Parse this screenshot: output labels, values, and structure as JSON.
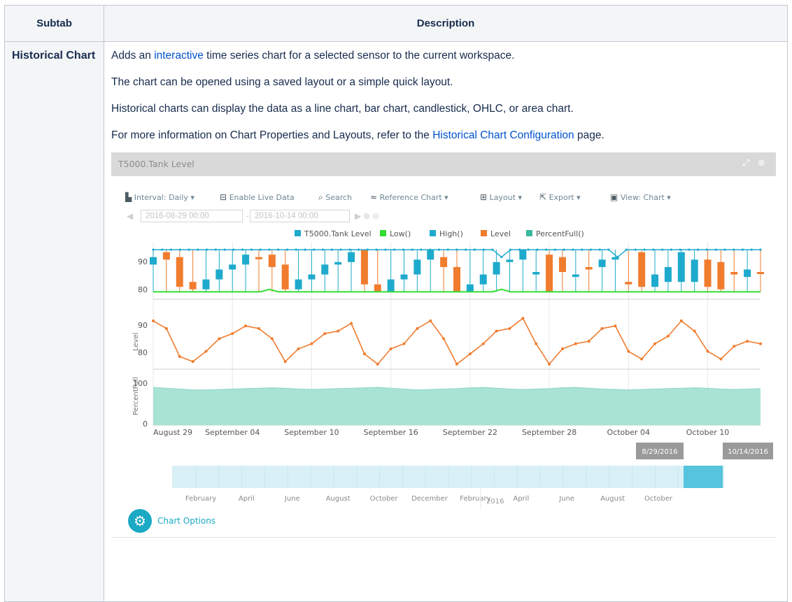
{
  "table": {
    "headers": [
      "Subtab",
      "Description"
    ],
    "row": {
      "subtab": "Historical Chart",
      "p1_before": "Adds an ",
      "p1_link": "interactive",
      "p1_after": " time series chart for a selected sensor to the current workspace.",
      "p2": "The chart can be opened using a saved layout or a simple quick layout.",
      "p3": "Historical charts can display the data as a line chart, bar chart, candlestick, OHLC, or area chart.",
      "p4_before": "For more information on Chart Properties and Layouts, refer to the ",
      "p4_link": "Historical Chart Configuration",
      "p4_after": " page."
    }
  },
  "widget": {
    "title": "T5000.Tank Level",
    "toolbar": {
      "interval": "Interval: Daily",
      "live": "Enable Live Data",
      "search": "Search",
      "reference": "Reference Chart",
      "layout": "Layout",
      "export": "Export",
      "view": "View: Chart"
    },
    "date_from": "2016-08-29 00:00",
    "date_to": "2016-10-14 00:00",
    "range_start_label": "8/29/2016",
    "range_end_label": "10/14/2016",
    "chart_options": "Chart Options",
    "icons": [
      "interval-icon",
      "live-data-icon",
      "search-icon",
      "reference-chart-icon",
      "layout-icon",
      "export-icon",
      "view-icon",
      "expand-icon",
      "close-icon",
      "gear-icon"
    ],
    "colors": {
      "accent": "#1ba9c4",
      "level": "#f07c2e",
      "low": "#33dd33",
      "high": "#1eaacc",
      "percent": "#9fe0cf"
    }
  },
  "chart_data": [
    {
      "type": "candlestick",
      "legend": [
        "T5000.Tank Level",
        "Low()",
        "High()",
        "Level",
        "PercentFull()"
      ],
      "yticks": [
        80,
        90
      ],
      "ylim": [
        75,
        97
      ],
      "x_start": "2016-08-29",
      "x_end": "2016-10-14",
      "high": [
        95,
        95,
        95,
        95,
        95,
        95,
        95,
        95,
        95,
        95,
        95,
        95,
        95,
        95,
        95,
        95,
        95,
        95,
        95,
        95,
        95,
        95,
        95,
        95,
        95,
        95,
        95,
        95,
        95,
        95,
        95,
        95,
        95,
        95,
        95,
        95,
        95,
        95,
        95,
        92,
        95,
        95,
        95,
        95,
        95,
        95,
        95,
        95,
        95,
        95,
        95,
        95,
        92,
        95,
        95,
        95,
        95,
        95,
        95,
        95,
        95,
        95,
        95,
        95,
        95,
        95,
        95,
        95,
        95
      ],
      "low": [
        78,
        78,
        78,
        78,
        78,
        78,
        78,
        78,
        78,
        78,
        78,
        78,
        78,
        79,
        78,
        78,
        78,
        78,
        78,
        78,
        78,
        78,
        78,
        78,
        78,
        78,
        78,
        78,
        78,
        78,
        78,
        78,
        78,
        78,
        78,
        78,
        78,
        78,
        78,
        79,
        78,
        78,
        78,
        78,
        78,
        78,
        78,
        78,
        78,
        78,
        78,
        78,
        78,
        78,
        78,
        78,
        78,
        78,
        78,
        78,
        78,
        78,
        78,
        78,
        78,
        78,
        78,
        78,
        78
      ],
      "candles": [
        {
          "o": 92,
          "c": 89,
          "dir": "up"
        },
        {
          "o": 94,
          "c": 91,
          "dir": "down"
        },
        {
          "o": 92,
          "c": 80,
          "dir": "down"
        },
        {
          "o": 82,
          "c": 79,
          "dir": "down"
        },
        {
          "o": 79,
          "c": 83,
          "dir": "up"
        },
        {
          "o": 83,
          "c": 87,
          "dir": "up"
        },
        {
          "o": 87,
          "c": 89,
          "dir": "up"
        },
        {
          "o": 89,
          "c": 93,
          "dir": "up"
        },
        {
          "o": 92,
          "c": 92,
          "dir": "down"
        },
        {
          "o": 93,
          "c": 88,
          "dir": "down"
        },
        {
          "o": 89,
          "c": 79,
          "dir": "down"
        },
        {
          "o": 79,
          "c": 83,
          "dir": "up"
        },
        {
          "o": 83,
          "c": 85,
          "dir": "up"
        },
        {
          "o": 85,
          "c": 89,
          "dir": "up"
        },
        {
          "o": 89,
          "c": 90,
          "dir": "up"
        },
        {
          "o": 90,
          "c": 94,
          "dir": "up"
        },
        {
          "o": 95,
          "c": 81,
          "dir": "down"
        },
        {
          "o": 81,
          "c": 78,
          "dir": "down"
        },
        {
          "o": 78,
          "c": 83,
          "dir": "up"
        },
        {
          "o": 83,
          "c": 85,
          "dir": "up"
        },
        {
          "o": 85,
          "c": 91,
          "dir": "up"
        },
        {
          "o": 91,
          "c": 95,
          "dir": "up"
        },
        {
          "o": 92,
          "c": 88,
          "dir": "down"
        },
        {
          "o": 88,
          "c": 78,
          "dir": "down"
        },
        {
          "o": 78,
          "c": 81,
          "dir": "up"
        },
        {
          "o": 81,
          "c": 85,
          "dir": "up"
        },
        {
          "o": 85,
          "c": 90,
          "dir": "up"
        },
        {
          "o": 90,
          "c": 91,
          "dir": "up"
        },
        {
          "o": 91,
          "c": 95,
          "dir": "up"
        },
        {
          "o": 85,
          "c": 86,
          "dir": "up"
        },
        {
          "o": 93,
          "c": 78,
          "dir": "down"
        },
        {
          "o": 92,
          "c": 86,
          "dir": "down"
        },
        {
          "o": 84,
          "c": 85,
          "dir": "up"
        },
        {
          "o": 87,
          "c": 88,
          "dir": "down"
        },
        {
          "o": 88,
          "c": 91,
          "dir": "up"
        },
        {
          "o": 91,
          "c": 92,
          "dir": "up"
        },
        {
          "o": 82,
          "c": 81,
          "dir": "down"
        },
        {
          "o": 94,
          "c": 80,
          "dir": "down"
        },
        {
          "o": 80,
          "c": 85,
          "dir": "up"
        },
        {
          "o": 82,
          "c": 88,
          "dir": "up"
        },
        {
          "o": 82,
          "c": 94,
          "dir": "up"
        },
        {
          "o": 82,
          "c": 91,
          "dir": "up"
        },
        {
          "o": 91,
          "c": 80,
          "dir": "down"
        },
        {
          "o": 90,
          "c": 79,
          "dir": "down"
        },
        {
          "o": 85,
          "c": 86,
          "dir": "down"
        },
        {
          "o": 84,
          "c": 87,
          "dir": "up"
        },
        {
          "o": 86,
          "c": 86,
          "dir": "down"
        }
      ]
    },
    {
      "type": "line",
      "series": [
        {
          "name": "Level",
          "values": [
            94,
            91,
            80,
            78,
            82,
            87,
            89,
            92,
            91,
            87,
            78,
            83,
            85,
            89,
            90,
            93,
            81,
            77,
            83,
            85,
            91,
            94,
            87,
            77,
            81,
            85,
            90,
            91,
            95,
            85,
            77,
            83,
            85,
            86,
            91,
            92,
            82,
            79,
            85,
            88,
            94,
            90,
            82,
            79,
            84,
            86,
            85
          ]
        }
      ],
      "ylabel": "Level",
      "yticks": [
        80,
        90
      ],
      "ylim": [
        75,
        97
      ]
    },
    {
      "type": "area",
      "series": [
        {
          "name": "PercentFull",
          "values": [
            90,
            88,
            86,
            84,
            84,
            85,
            86,
            87,
            88,
            89,
            88,
            86,
            85,
            86,
            87,
            88,
            89,
            90,
            88,
            86,
            84,
            85,
            86,
            87,
            89,
            90,
            88,
            86,
            85,
            86,
            87,
            89,
            90,
            88,
            86,
            85,
            84,
            85,
            86,
            87,
            88,
            89,
            88,
            86,
            85,
            86,
            87
          ]
        }
      ],
      "ylabel": "PercentFull",
      "yticks": [
        0,
        100
      ],
      "ylim": [
        0,
        100
      ],
      "xticks": [
        "August 29",
        "September 04",
        "September 10",
        "September 16",
        "September 22",
        "September 28",
        "October 04",
        "October 10"
      ]
    },
    {
      "type": "area",
      "role": "navigator",
      "xticks": [
        "February",
        "April",
        "June",
        "August",
        "October",
        "December",
        "February",
        "April",
        "June",
        "August",
        "October"
      ],
      "year_label": "2016",
      "selected_range": [
        "8/29/2016",
        "10/14/2016"
      ]
    }
  ]
}
